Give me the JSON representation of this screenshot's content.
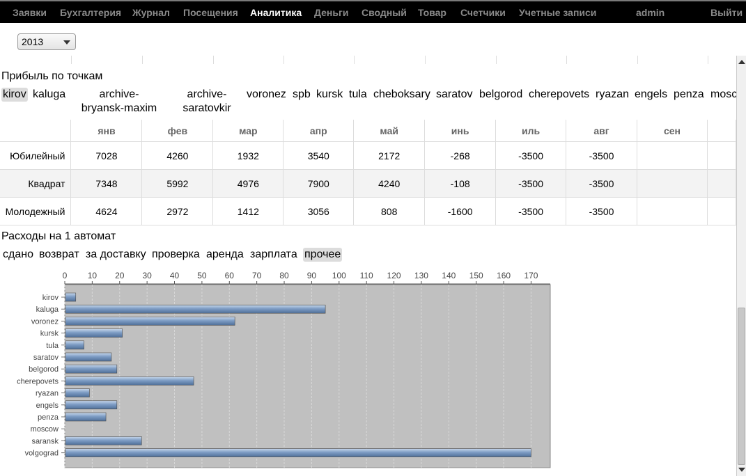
{
  "nav": [
    {
      "label": "Заявки",
      "active": false
    },
    {
      "label": "Бухгалтерия",
      "active": false
    },
    {
      "label": "Журнал",
      "active": false
    },
    {
      "label": "Посещения",
      "active": false
    },
    {
      "label": "Аналитика",
      "active": true
    },
    {
      "label": "Деньги",
      "active": false
    },
    {
      "label": "Сводный",
      "active": false
    },
    {
      "label": "Товар",
      "active": false
    },
    {
      "label": "Счетчики",
      "active": false
    },
    {
      "label": "Учетные записи",
      "active": false
    }
  ],
  "user": "admin",
  "logout": "Выйти",
  "year_select": {
    "value": "2013"
  },
  "profit": {
    "title": "Прибыль по точкам",
    "tabs": [
      {
        "label": "kirov",
        "selected": true
      },
      {
        "label": "kaluga",
        "selected": false
      },
      {
        "label": "archive-bryansk-maxim",
        "selected": false
      },
      {
        "label": "archive-saratovkir",
        "selected": false
      },
      {
        "label": "voronez",
        "selected": false
      },
      {
        "label": "spb",
        "selected": false
      },
      {
        "label": "kursk",
        "selected": false
      },
      {
        "label": "tula",
        "selected": false
      },
      {
        "label": "cheboksary",
        "selected": false
      },
      {
        "label": "saratov",
        "selected": false
      },
      {
        "label": "belgorod",
        "selected": false
      },
      {
        "label": "cherepovets",
        "selected": false
      },
      {
        "label": "ryazan",
        "selected": false
      },
      {
        "label": "engels",
        "selected": false
      },
      {
        "label": "penza",
        "selected": false
      },
      {
        "label": "mosco",
        "selected": false
      }
    ],
    "columns": [
      "янв",
      "фев",
      "мар",
      "апр",
      "май",
      "инь",
      "иль",
      "авг",
      "сен",
      ""
    ],
    "rows": [
      {
        "name": "Юбилейный",
        "values": [
          "7028",
          "4260",
          "1932",
          "3540",
          "2172",
          "-268",
          "-3500",
          "-3500",
          "",
          ""
        ]
      },
      {
        "name": "Квадрат",
        "values": [
          "7348",
          "5992",
          "4976",
          "7900",
          "4240",
          "-108",
          "-3500",
          "-3500",
          "",
          ""
        ]
      },
      {
        "name": "Молодежный",
        "values": [
          "4624",
          "2972",
          "1412",
          "3056",
          "808",
          "-1600",
          "-3500",
          "-3500",
          "",
          ""
        ]
      }
    ]
  },
  "expenses": {
    "title": "Расходы на 1 автомат",
    "tabs": [
      {
        "label": "сдано",
        "selected": false
      },
      {
        "label": "возврат",
        "selected": false
      },
      {
        "label": "за доставку",
        "selected": false
      },
      {
        "label": "проверка",
        "selected": false
      },
      {
        "label": "аренда",
        "selected": false
      },
      {
        "label": "зарплата",
        "selected": false
      },
      {
        "label": "прочее",
        "selected": true
      }
    ]
  },
  "chart_data": {
    "type": "bar",
    "orientation": "horizontal",
    "categories": [
      "kirov",
      "kaluga",
      "voronez",
      "kursk",
      "tula",
      "saratov",
      "belgorod",
      "cherepovets",
      "ryazan",
      "engels",
      "penza",
      "moscow",
      "saransk",
      "volgograd"
    ],
    "values": [
      4,
      95,
      62,
      21,
      7,
      17,
      19,
      47,
      9,
      19,
      15,
      0,
      28,
      170
    ],
    "xlim": [
      0,
      177
    ],
    "xticks": [
      0,
      10,
      20,
      30,
      40,
      50,
      60,
      70,
      80,
      90,
      100,
      110,
      120,
      130,
      140,
      150,
      160,
      170
    ],
    "xaxis_position": "top",
    "grid": true,
    "bar_color": "#6f90b8",
    "background_color": "#c0c0c0"
  }
}
